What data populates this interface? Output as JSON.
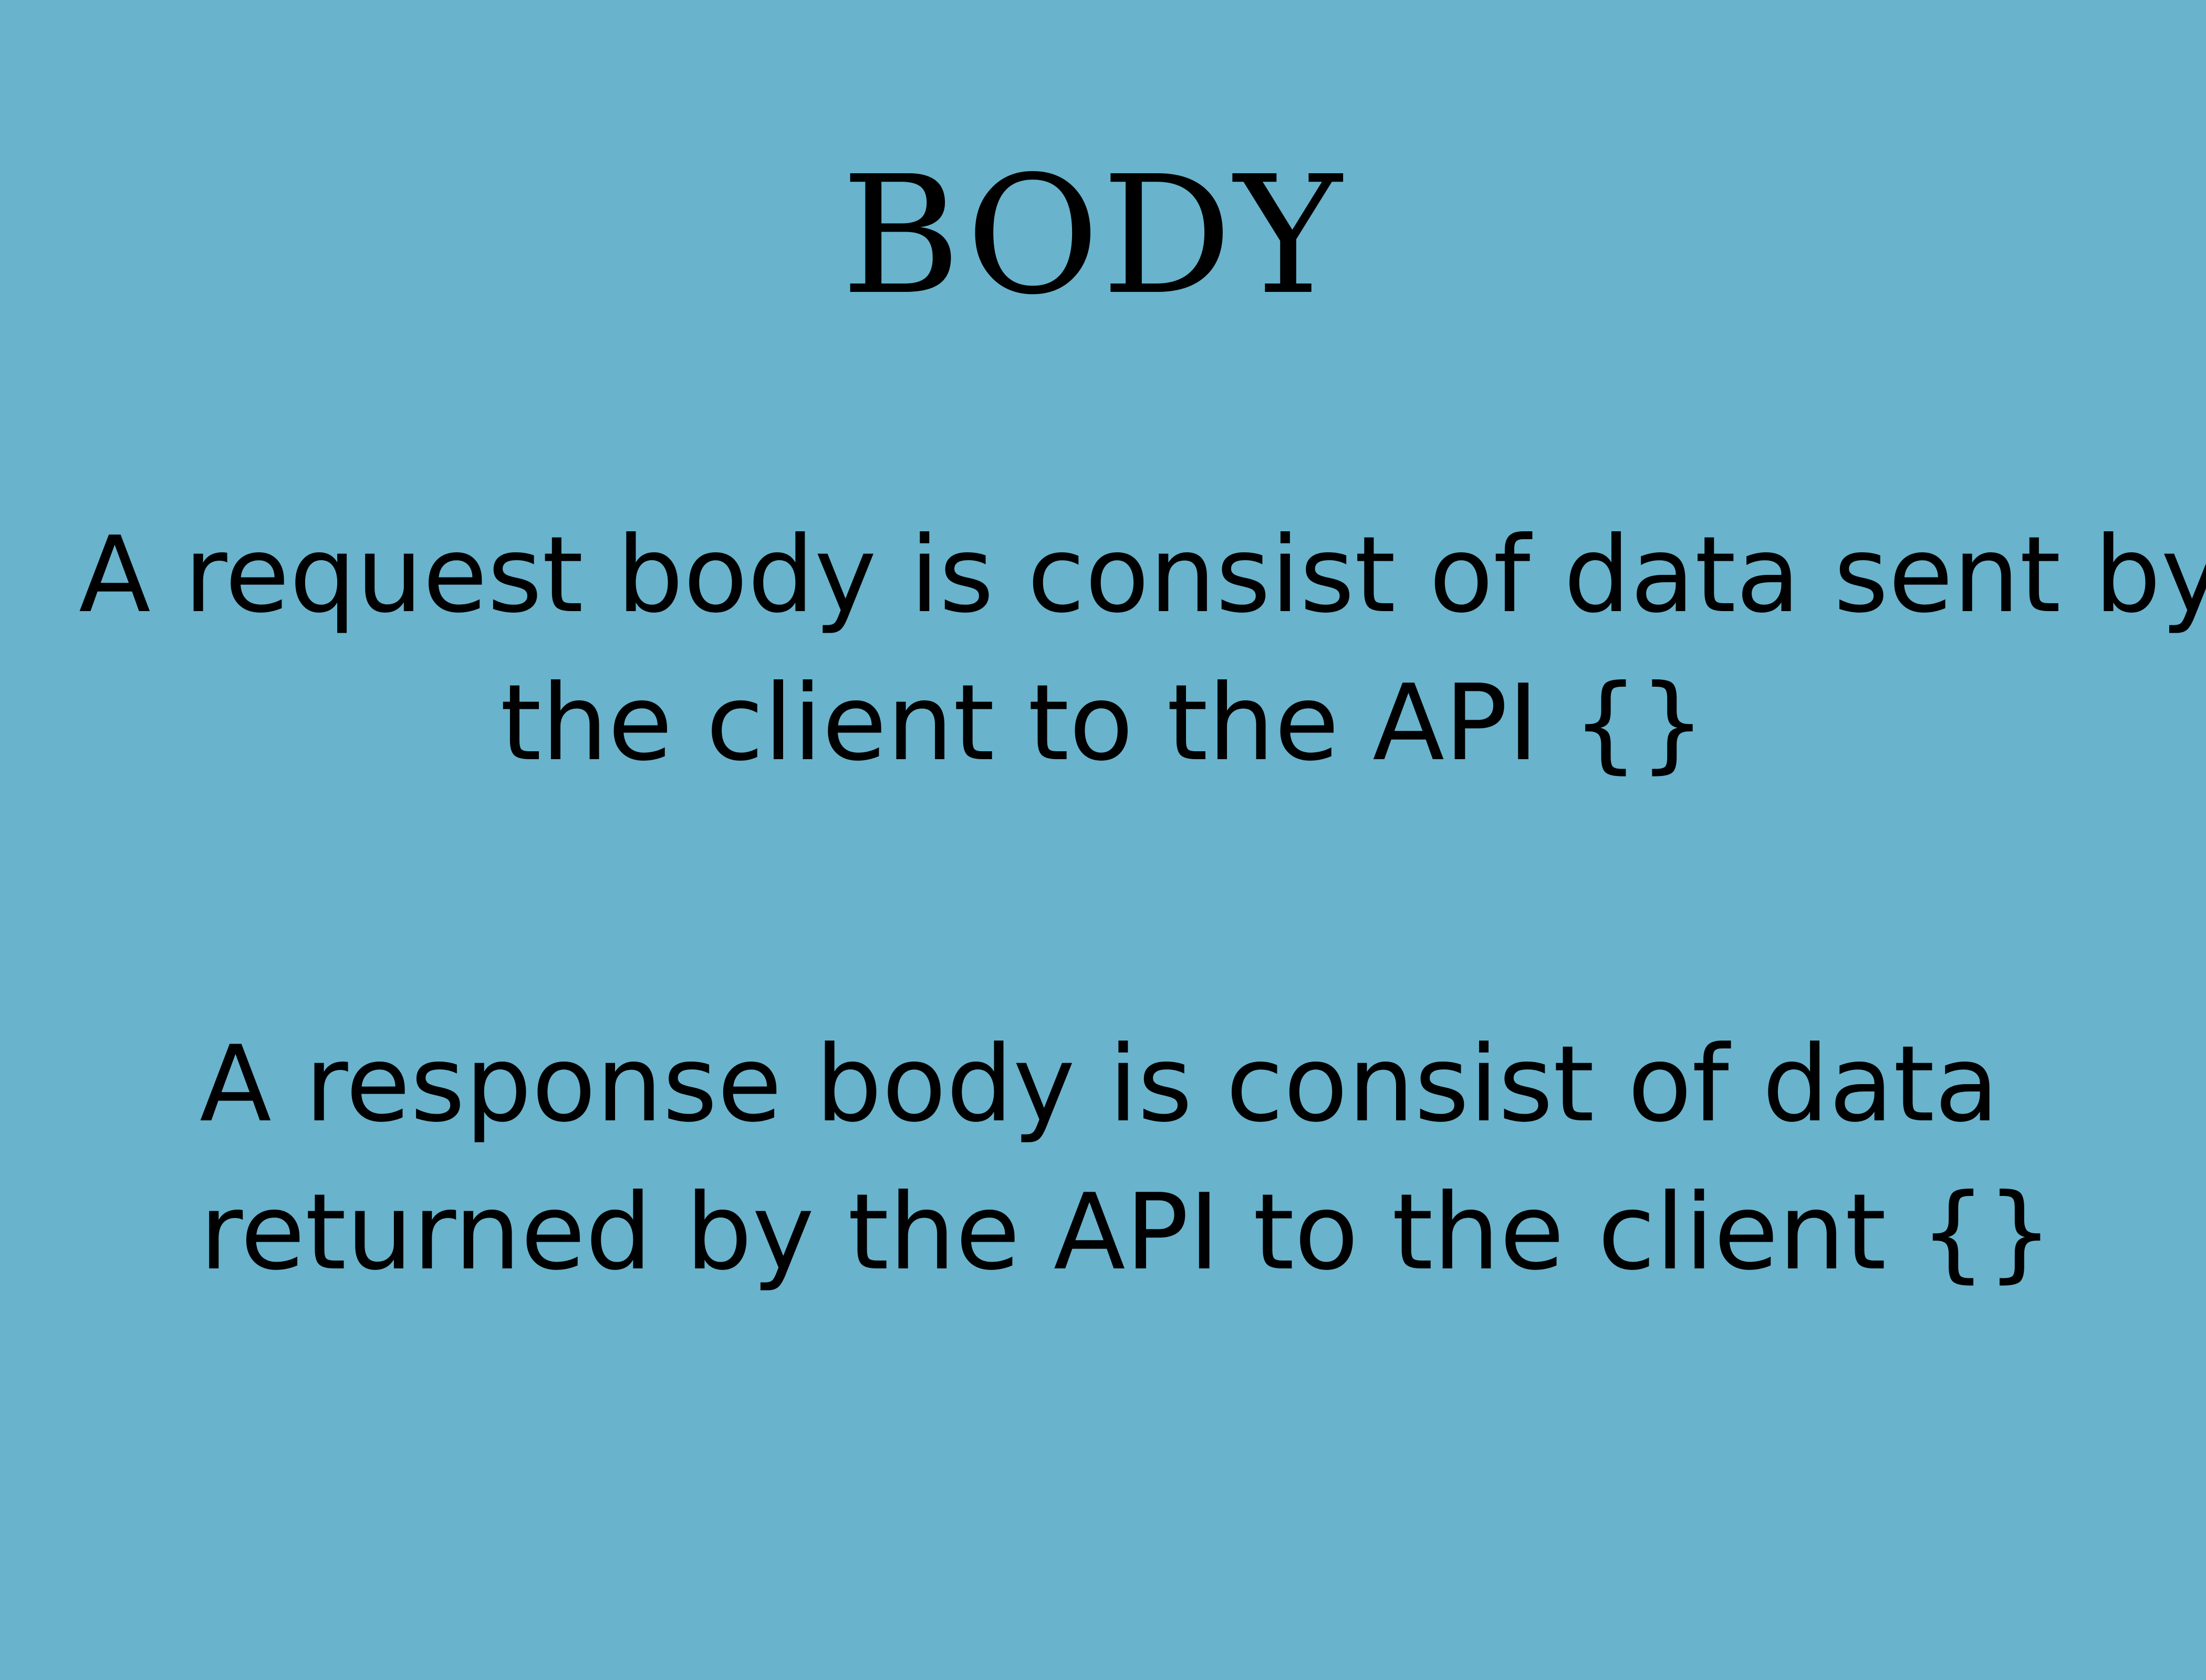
{
  "slide": {
    "title": "BODY",
    "request": {
      "line1": "A request body is consist of data sent by",
      "line2": "the client to the API {}"
    },
    "response": {
      "line1": "A response body is consist of data",
      "line2": "returned by the API to the client {}"
    }
  },
  "colors": {
    "background": "#69b3cc",
    "text": "#000000"
  }
}
